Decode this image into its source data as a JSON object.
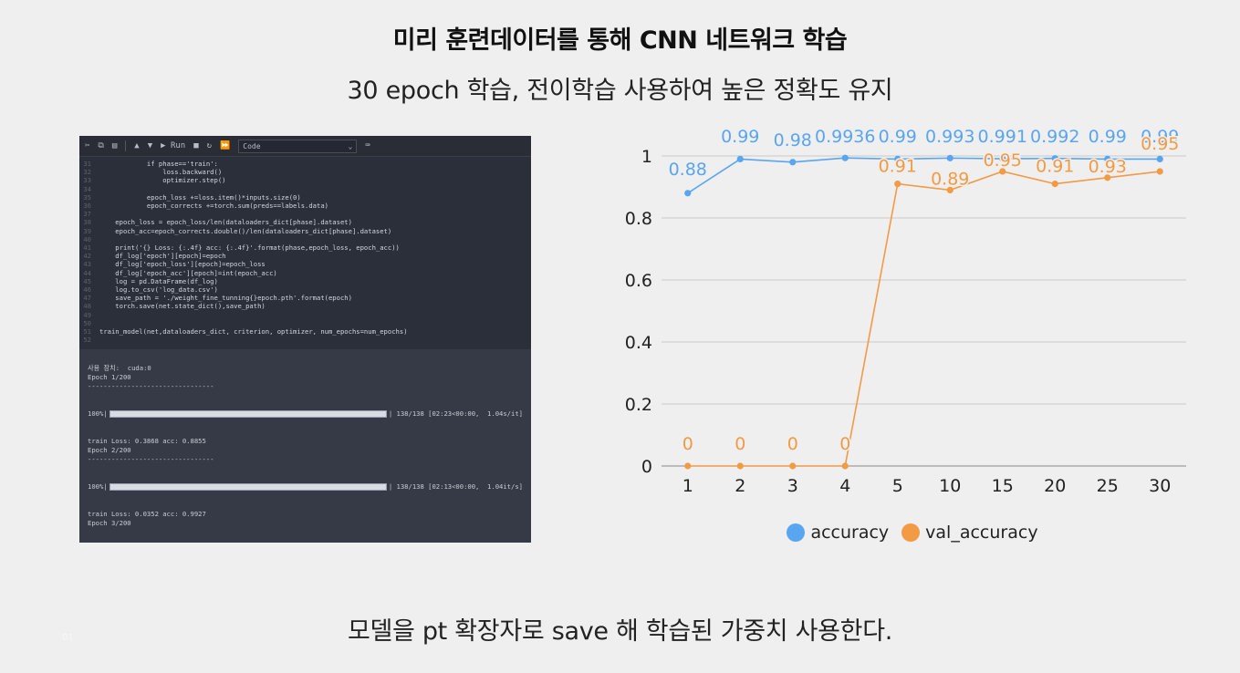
{
  "slide": {
    "title": "미리 훈련데이터를 통해 CNN 네트워크 학습",
    "subtitle": "30 epoch 학습, 전이학습 사용하여 높은 정확도 유지",
    "footer": "모델을 pt 확장자로 save 해 학습된 가중치 사용한다.",
    "page_number": "01"
  },
  "notebook": {
    "toolbar": {
      "run_label": "▶ Run",
      "cell_type": "Code"
    },
    "code_lines": [
      "            if phase=='train':",
      "                loss.backward()",
      "                optimizer.step()",
      "",
      "            epoch_loss +=loss.item()*inputs.size(0)",
      "            epoch_corrects +=torch.sum(preds==labels.data)",
      "",
      "    epoch_loss = epoch_loss/len(dataloaders_dict[phase].dataset)",
      "    epoch_acc=epoch_corrects.double()/len(dataloaders_dict[phase].dataset)",
      "",
      "    print('{} Loss: {:.4f} acc: {:.4f}'.format(phase,epoch_loss, epoch_acc))",
      "    df_log['epoch'][epoch]=epoch",
      "    df_log['epoch_loss'][epoch]=epoch_loss",
      "    df_log['epoch_acc'][epoch]=int(epoch_acc)",
      "    log = pd.DataFrame(df_log)",
      "    log.to_csv('log_data.csv')",
      "    save_path = './weight_fine_tunning{}epoch.pth'.format(epoch)",
      "    torch.save(net.state_dict(),save_path)",
      "",
      "",
      "train_model(net,dataloaders_dict, criterion, optimizer, num_epochs=num_epochs)",
      ""
    ],
    "gutter_start": 31,
    "output": {
      "device_line": "사용 장치:  cuda:0",
      "epoch1": "Epoch 1/200",
      "divider": "--------------------------------",
      "progress1_prefix": "100%|",
      "progress1_suffix": "| 138/138 [02:23<00:00,  1.04s/it]",
      "progress1_fraction": 1.0,
      "train1": "train Loss: 0.3868 acc: 0.8855",
      "epoch2": "Epoch 2/200",
      "progress2_prefix": "100%|",
      "progress2_suffix": "| 138/138 [02:13<00:00,  1.04it/s]",
      "progress2_fraction": 1.0,
      "train2": "train Loss: 0.0352 acc: 0.9927",
      "epoch3": "Epoch 3/200"
    }
  },
  "chart_data": {
    "type": "line",
    "categories": [
      "1",
      "2",
      "3",
      "4",
      "5",
      "10",
      "15",
      "20",
      "25",
      "30"
    ],
    "ylim": [
      0,
      1
    ],
    "yticks": [
      "0",
      "0.2",
      "0.4",
      "0.6",
      "0.8",
      "1"
    ],
    "grid": true,
    "legend_position": "bottom",
    "series": [
      {
        "name": "accuracy",
        "color": "#5aa5ef",
        "values": [
          0.88,
          0.99,
          0.98,
          0.9936,
          0.99,
          0.993,
          0.991,
          0.992,
          0.99,
          0.99
        ],
        "labels": [
          "0.88",
          "0.99",
          "0.98",
          "0.9936",
          "0.99",
          "0.993",
          "0.991",
          "0.992",
          "0.99",
          "0.99"
        ]
      },
      {
        "name": "val_accuracy",
        "color": "#f39a45",
        "values": [
          0,
          0,
          0,
          0,
          0.91,
          0.89,
          0.95,
          0.91,
          0.93,
          0.95
        ],
        "labels": [
          "0",
          "0",
          "0",
          "0",
          "0.91",
          "0.89",
          "0.95",
          "0.91",
          "0.93",
          "0.95"
        ]
      }
    ]
  }
}
